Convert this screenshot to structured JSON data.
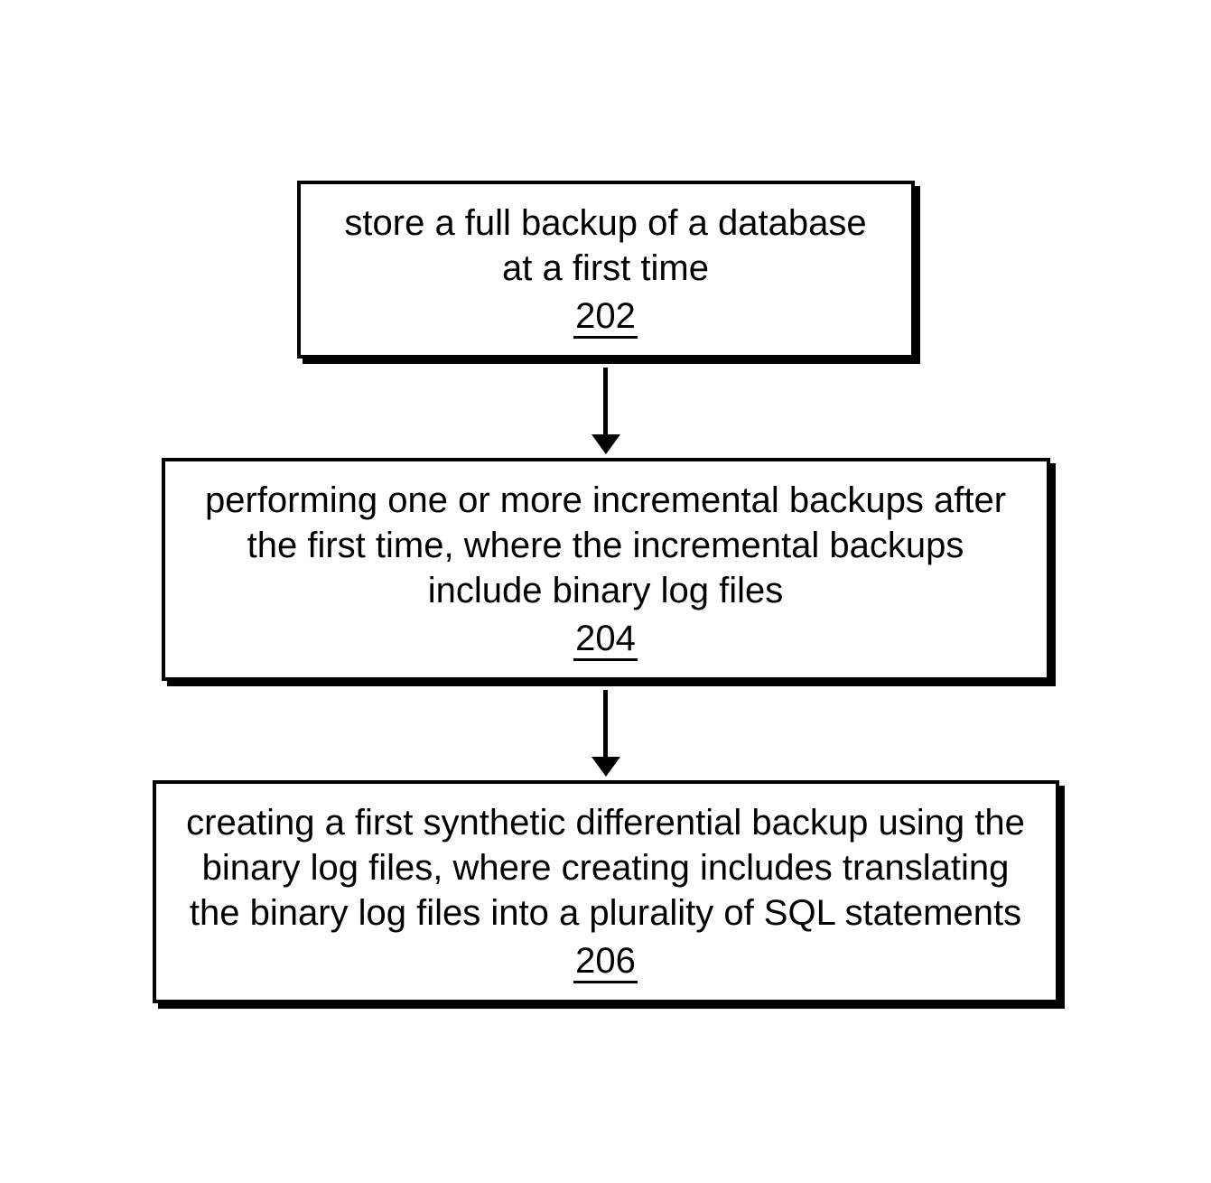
{
  "diagram": {
    "steps": [
      {
        "text": "store a full backup of a database at a first time",
        "ref": "202"
      },
      {
        "text": "performing one or more incremental backups after the first time, where the incremental backups include binary log files",
        "ref": "204"
      },
      {
        "text": "creating a first synthetic differential backup using the binary log files, where creating includes translating the binary log files into a plurality of SQL statements",
        "ref": "206"
      }
    ]
  }
}
